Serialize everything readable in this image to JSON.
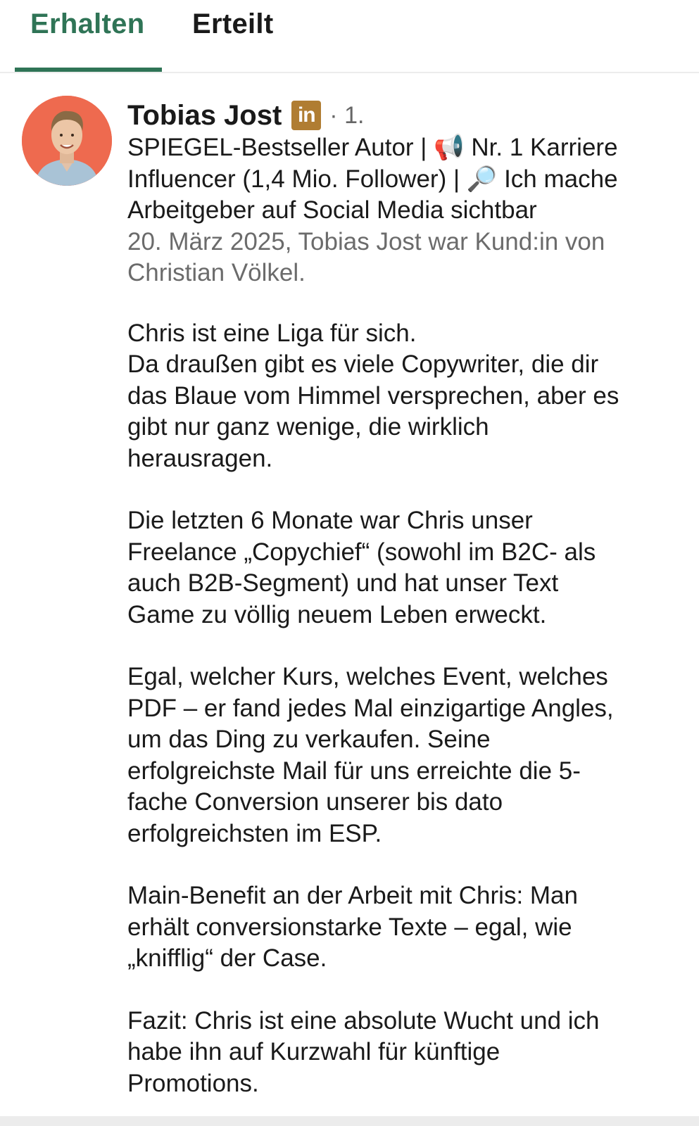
{
  "tabs": {
    "received": "Erhalten",
    "given": "Erteilt",
    "active_color": "#2f7456"
  },
  "recommendation": {
    "author_name": "Tobias Jost",
    "linkedin_badge": "in",
    "connection_degree": "· 1.",
    "headline_lines": [
      "SPIEGEL-Bestseller Autor | 📢 Nr. 1 Karriere",
      "Influencer (1,4 Mio. Follower) | 🔎 Ich mache",
      "Arbeitgeber auf Social Media sichtbar"
    ],
    "meta_lines": [
      "20. März 2025, Tobias Jost war Kund:in von",
      "Christian Völkel."
    ],
    "body": [
      [
        "Chris ist eine Liga für sich.",
        "Da draußen gibt es viele Copywriter, die dir",
        "das Blaue vom Himmel versprechen, aber es",
        "gibt nur ganz wenige, die wirklich",
        "herausragen."
      ],
      [
        "Die letzten 6 Monate war Chris unser",
        "Freelance „Copychief“ (sowohl im B2C- als",
        "auch B2B-Segment) und hat unser Text",
        "Game zu völlig neuem Leben erweckt."
      ],
      [
        "Egal, welcher Kurs, welches Event, welches",
        "PDF – er fand jedes Mal einzigartige Angles,",
        "um das Ding zu verkaufen. Seine",
        "erfolgreichste Mail für uns erreichte die 5-",
        "fache Conversion unserer bis dato",
        "erfolgreichsten im ESP."
      ],
      [
        "Main-Benefit an der Arbeit mit Chris: Man",
        "erhält conversionstarke Texte – egal, wie",
        "„knifflig“ der Case."
      ],
      [
        "Fazit: Chris ist eine absolute Wucht und ich",
        "habe ihn auf Kurzwahl für künftige",
        "Promotions."
      ]
    ]
  }
}
